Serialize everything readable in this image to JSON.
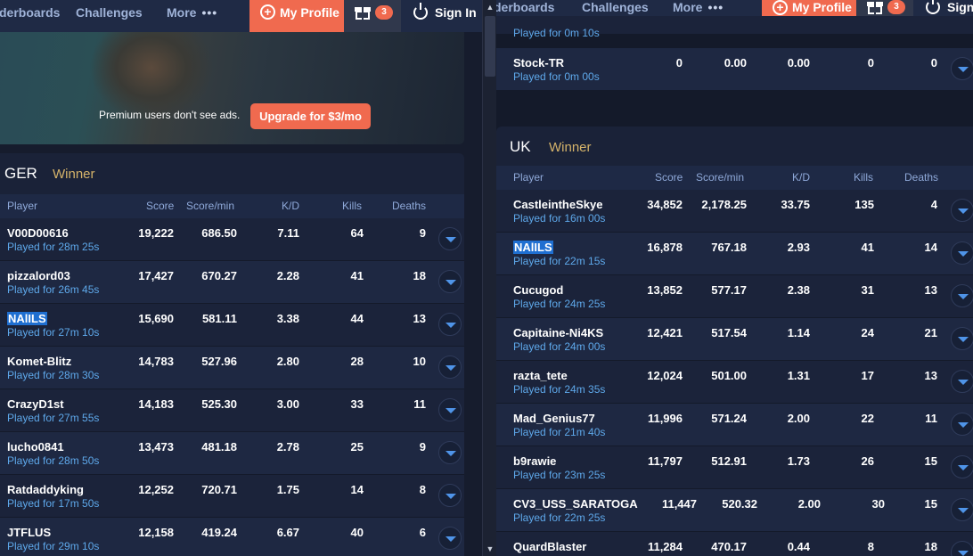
{
  "nav": {
    "leaderboards": "derboards",
    "leaderboards_right": "derboards",
    "challenges": "Challenges",
    "more": "More",
    "more_dots": "•••",
    "my_profile": "My Profile",
    "gift_count": "3",
    "sign_in": "Sign In",
    "sign_in_right": "Sign"
  },
  "ad": {
    "text": "Premium users don't see ads.",
    "button": "Upgrade for $3/mo"
  },
  "columns": {
    "player": "Player",
    "score": "Score",
    "score_min": "Score/min",
    "kd": "K/D",
    "kills": "Kills",
    "deaths": "Deaths"
  },
  "left_card": {
    "region": "GER",
    "winner": "Winner",
    "rows": [
      {
        "name": "V00D00616",
        "played": "Played for 28m 25s",
        "score": "19,222",
        "score_min": "686.50",
        "kd": "7.11",
        "kills": "64",
        "deaths": "9"
      },
      {
        "name": "pizzalord03",
        "played": "Played for 26m 45s",
        "score": "17,427",
        "score_min": "670.27",
        "kd": "2.28",
        "kills": "41",
        "deaths": "18"
      },
      {
        "name": "NAlILS",
        "played": "Played for 27m 10s",
        "score": "15,690",
        "score_min": "581.11",
        "kd": "3.38",
        "kills": "44",
        "deaths": "13"
      },
      {
        "name": "Komet-Blitz",
        "played": "Played for 28m 30s",
        "score": "14,783",
        "score_min": "527.96",
        "kd": "2.80",
        "kills": "28",
        "deaths": "10"
      },
      {
        "name": "CrazyD1st",
        "played": "Played for 27m 55s",
        "score": "14,183",
        "score_min": "525.30",
        "kd": "3.00",
        "kills": "33",
        "deaths": "11"
      },
      {
        "name": "lucho0841",
        "played": "Played for 28m 50s",
        "score": "13,473",
        "score_min": "481.18",
        "kd": "2.78",
        "kills": "25",
        "deaths": "9"
      },
      {
        "name": "Ratdaddyking",
        "played": "Played for 17m 50s",
        "score": "12,252",
        "score_min": "720.71",
        "kd": "1.75",
        "kills": "14",
        "deaths": "8"
      },
      {
        "name": "JTFLUS",
        "played": "Played for 29m 10s",
        "score": "12,158",
        "score_min": "419.24",
        "kd": "6.67",
        "kills": "40",
        "deaths": "6"
      }
    ]
  },
  "right_top": {
    "prev_played": "Played for 0m 10s",
    "row": {
      "name": "Stock-TR",
      "played": "Played for 0m 00s",
      "score": "0",
      "score_min": "0.00",
      "kd": "0.00",
      "kills": "0",
      "deaths": "0"
    }
  },
  "right_card": {
    "region": "UK",
    "winner": "Winner",
    "rows": [
      {
        "name": "CastleintheSkye",
        "played": "Played for 16m 00s",
        "score": "34,852",
        "score_min": "2,178.25",
        "kd": "33.75",
        "kills": "135",
        "deaths": "4"
      },
      {
        "name": "NAlILS",
        "played": "Played for 22m 15s",
        "score": "16,878",
        "score_min": "767.18",
        "kd": "2.93",
        "kills": "41",
        "deaths": "14"
      },
      {
        "name": "Cucugod",
        "played": "Played for 24m 25s",
        "score": "13,852",
        "score_min": "577.17",
        "kd": "2.38",
        "kills": "31",
        "deaths": "13"
      },
      {
        "name": "Capitaine-Ni4KS",
        "played": "Played for 24m 00s",
        "score": "12,421",
        "score_min": "517.54",
        "kd": "1.14",
        "kills": "24",
        "deaths": "21"
      },
      {
        "name": "razta_tete",
        "played": "Played for 24m 35s",
        "score": "12,024",
        "score_min": "501.00",
        "kd": "1.31",
        "kills": "17",
        "deaths": "13"
      },
      {
        "name": "Mad_Genius77",
        "played": "Played for 21m 40s",
        "score": "11,996",
        "score_min": "571.24",
        "kd": "2.00",
        "kills": "22",
        "deaths": "11"
      },
      {
        "name": "b9rawie",
        "played": "Played for 23m 25s",
        "score": "11,797",
        "score_min": "512.91",
        "kd": "1.73",
        "kills": "26",
        "deaths": "15"
      },
      {
        "name": "CV3_USS_SARATOGA",
        "played": "Played for 22m 25s",
        "score": "11,447",
        "score_min": "520.32",
        "kd": "2.00",
        "kills": "30",
        "deaths": "15"
      },
      {
        "name": "QuardBlaster",
        "played": "",
        "score": "11,284",
        "score_min": "470.17",
        "kd": "0.44",
        "kills": "8",
        "deaths": "18"
      }
    ]
  },
  "colors": {
    "accent": "#f06a4f",
    "winner": "#d5b36a",
    "played": "#5ea8ea",
    "header": "#8fa9d9"
  }
}
